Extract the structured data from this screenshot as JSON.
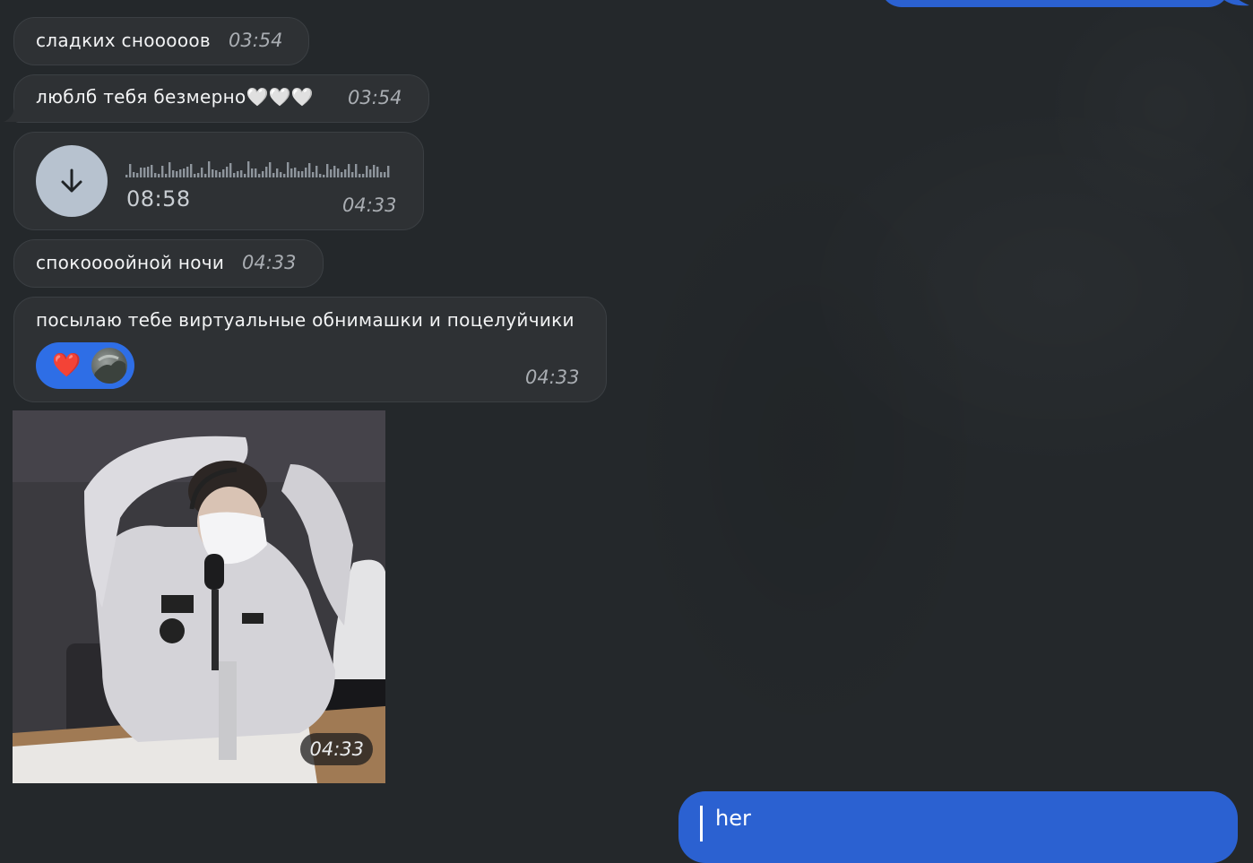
{
  "messages": [
    {
      "text": "сладких снооооов",
      "time": "03:54"
    },
    {
      "text": "люблб тебя безмерно🤍🤍🤍",
      "time": "03:54"
    },
    {
      "voice_duration": "08:58",
      "time": "04:33"
    },
    {
      "text": "спокоооойной ночи",
      "time": "04:33"
    },
    {
      "text": "посылаю тебе виртуальные обнимашки и поцелуйчики",
      "time": "04:33",
      "reaction": "❤️"
    },
    {
      "photo_time": "04:33"
    }
  ],
  "input": {
    "value": "her"
  },
  "colors": {
    "background": "#24282b",
    "incoming_bubble": "#2e3134",
    "outgoing_bubble": "#2b61d1",
    "reaction_pill": "#2e6ee6",
    "voice_button": "#b7c2cf"
  },
  "icons": {
    "voice_download": "arrow-down-icon",
    "reaction": "heart-icon"
  }
}
